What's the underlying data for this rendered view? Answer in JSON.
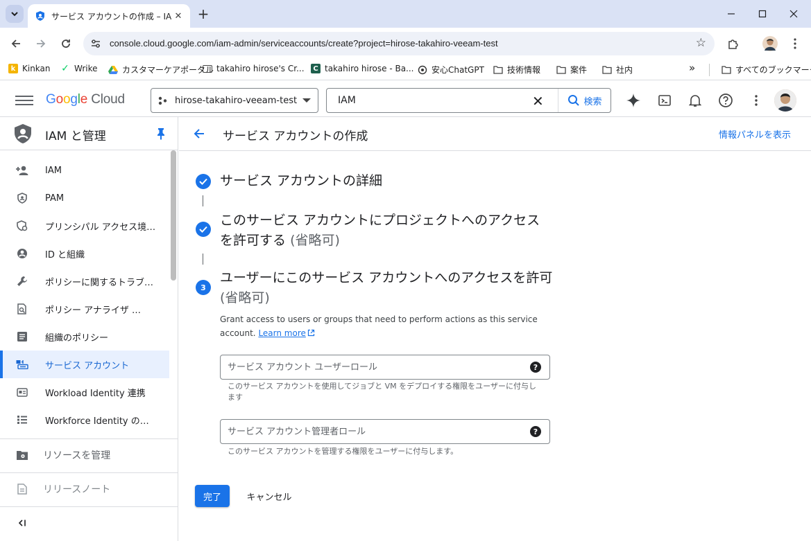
{
  "browser": {
    "tab_title": "サービス アカウントの作成 – IAM と管理",
    "url": "console.cloud.google.com/iam-admin/serviceaccounts/create?project=hirose-takahiro-veeam-test",
    "bookmarks": [
      "Kinkan",
      "Wrike",
      "カスタマーケアポータル",
      "takahiro hirose's Cr...",
      "takahiro hirose - Ba...",
      "安心ChatGPT",
      "技術情報",
      "案件",
      "社内"
    ],
    "all_bookmarks": "すべてのブックマーク",
    "more_bookmarks": "»"
  },
  "header": {
    "logo_google": "Google",
    "logo_cloud": "Cloud",
    "project": "hirose-takahiro-veeam-test",
    "search_value": "IAM",
    "search_button": "検索"
  },
  "sidebar": {
    "title": "IAM と管理",
    "items": [
      {
        "label": "IAM",
        "icon": "person-add-icon"
      },
      {
        "label": "PAM",
        "icon": "shield-icon"
      },
      {
        "label": "プリンシパル アクセス境…",
        "icon": "policy-icon"
      },
      {
        "label": "ID と組織",
        "icon": "account-circle-icon"
      },
      {
        "label": "ポリシーに関するトラブ…",
        "icon": "wrench-icon"
      },
      {
        "label": "ポリシー アナライザ …",
        "icon": "analyzer-icon"
      },
      {
        "label": "組織のポリシー",
        "icon": "list-alt-icon"
      },
      {
        "label": "サービス アカウント",
        "icon": "service-account-icon"
      },
      {
        "label": "Workload Identity 連携",
        "icon": "card-icon"
      },
      {
        "label": "Workforce Identity の連携",
        "icon": "list-icon"
      }
    ],
    "manage_resources": "リソースを管理",
    "release_notes": "リリースノート",
    "collapse": "<I"
  },
  "main": {
    "back_label": "←",
    "title": "サービス アカウントの作成",
    "info_panel": "情報パネルを表示",
    "steps": [
      {
        "title": "サービス アカウントの詳細",
        "optional": "",
        "state": "done"
      },
      {
        "title": "このサービス アカウントにプロジェクトへのアクセスを許可する",
        "optional": "(省略可)",
        "state": "done"
      },
      {
        "title": "ユーザーにこのサービス アカウントへのアクセスを許可",
        "optional": "(省略可)",
        "state": "current",
        "number": "3"
      }
    ],
    "description": "Grant access to users or groups that need to perform actions as this service account.",
    "learn_more": "Learn more",
    "fields": [
      {
        "placeholder": "サービス アカウント ユーザーロール",
        "value": "",
        "hint": "このサービス アカウントを使用してジョブと VM をデプロイする権限をユーザーに付与します"
      },
      {
        "placeholder": "サービス アカウント管理者ロール",
        "value": "",
        "hint": "このサービス アカウントを管理する権限をユーザーに付与します。"
      }
    ],
    "done_button": "完了",
    "cancel_button": "キャンセル"
  },
  "colors": {
    "accent": "#1a73e8",
    "active_bg": "#e8f0fe",
    "chrome_frame": "#dae2f5"
  }
}
